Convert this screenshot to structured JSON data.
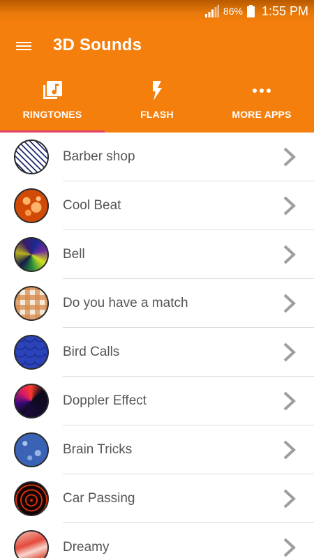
{
  "status_bar": {
    "battery_percent": "86%",
    "time": "1:55 PM",
    "signal_icon": "signal-bars-icon",
    "battery_icon": "battery-icon"
  },
  "app_bar": {
    "title": "3D Sounds",
    "menu_icon": "hamburger-menu-icon",
    "color": "#f57f0c"
  },
  "tabs": [
    {
      "label": "RINGTONES",
      "icon": "music-library-icon",
      "selected": true
    },
    {
      "label": "FLASH",
      "icon": "flash-icon",
      "selected": false
    },
    {
      "label": "MORE APPS",
      "icon": "more-dots-icon",
      "selected": false
    }
  ],
  "tab_indicator_color": "#e5426a",
  "sounds": [
    {
      "name": "Barber shop"
    },
    {
      "name": "Cool Beat"
    },
    {
      "name": "Bell"
    },
    {
      "name": "Do you have a match"
    },
    {
      "name": "Bird Calls"
    },
    {
      "name": "Doppler Effect"
    },
    {
      "name": "Brain Tricks"
    },
    {
      "name": "Car Passing"
    },
    {
      "name": "Dreamy"
    }
  ]
}
